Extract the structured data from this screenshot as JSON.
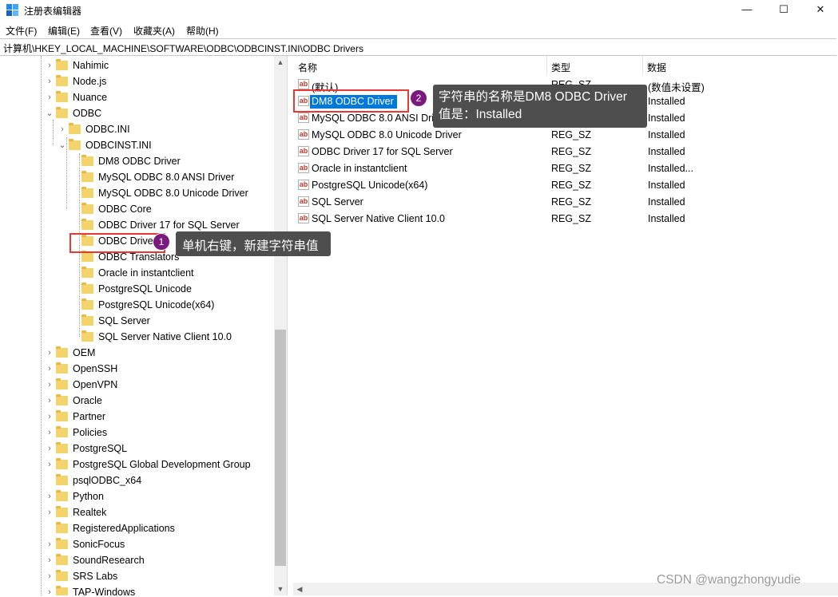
{
  "window": {
    "title": "注册表编辑器",
    "controls": {
      "minimize": "—",
      "maximize": "☐",
      "close": "✕"
    },
    "icon": "regedit-icon"
  },
  "menu": [
    "文件(F)",
    "编辑(E)",
    "查看(V)",
    "收藏夹(A)",
    "帮助(H)"
  ],
  "address": "计算机\\HKEY_LOCAL_MACHINE\\SOFTWARE\\ODBC\\ODBCINST.INI\\ODBC Drivers",
  "tree": {
    "top_items": [
      "Nahimic",
      "Node.js",
      "Nuance"
    ],
    "odbc": "ODBC",
    "odbc_ini": "ODBC.INI",
    "odbcinst_ini": "ODBCINST.INI",
    "odbcinst_children": [
      "DM8 ODBC Driver",
      "MySQL ODBC 8.0 ANSI Driver",
      "MySQL ODBC 8.0 Unicode Driver",
      "ODBC Core",
      "ODBC Driver 17 for SQL Server",
      "ODBC Drivers",
      "ODBC Translators",
      "Oracle in instantclient",
      "PostgreSQL Unicode",
      "PostgreSQL Unicode(x64)",
      "SQL Server",
      "SQL Server Native Client 10.0"
    ],
    "bottom_items": [
      "OEM",
      "OpenSSH",
      "OpenVPN",
      "Oracle",
      "Partner",
      "Policies",
      "PostgreSQL",
      "PostgreSQL Global Development Group",
      "psqlODBC_x64",
      "Python",
      "Realtek",
      "RegisteredApplications",
      "SonicFocus",
      "SoundResearch",
      "SRS Labs",
      "TAP-Windows"
    ]
  },
  "list": {
    "headers": {
      "name": "名称",
      "type": "类型",
      "data": "数据"
    },
    "rows": [
      {
        "name": "(默认)",
        "type": "REG_SZ",
        "data": "(数值未设置)"
      },
      {
        "name": "DM8 ODBC Driver",
        "type": "REG_SZ",
        "data": "Installed"
      },
      {
        "name": "MySQL ODBC 8.0 ANSI Driver",
        "type": "REG_SZ",
        "data": "Installed"
      },
      {
        "name": "MySQL ODBC 8.0 Unicode Driver",
        "type": "REG_SZ",
        "data": "Installed"
      },
      {
        "name": "ODBC Driver 17 for SQL Server",
        "type": "REG_SZ",
        "data": "Installed"
      },
      {
        "name": "Oracle in instantclient",
        "type": "REG_SZ",
        "data": "Installed..."
      },
      {
        "name": "PostgreSQL Unicode(x64)",
        "type": "REG_SZ",
        "data": "Installed"
      },
      {
        "name": "SQL Server",
        "type": "REG_SZ",
        "data": "Installed"
      },
      {
        "name": "SQL Server Native Client 10.0",
        "type": "REG_SZ",
        "data": "Installed"
      }
    ]
  },
  "annotations": {
    "step1": {
      "badge": "1",
      "text": "单机右键，新建字符串值"
    },
    "step2": {
      "badge": "2",
      "line1": "字符串的名称是DM8 ODBC Driver",
      "line2": "值是：Installed"
    }
  },
  "watermark": "CSDN @wangzhongyudie",
  "colors": {
    "selection": "#0078d7",
    "callout": "#4e4e4e",
    "badge": "#7b1a7e",
    "highlight_box": "#e53935",
    "folder": "#f4d36d"
  }
}
